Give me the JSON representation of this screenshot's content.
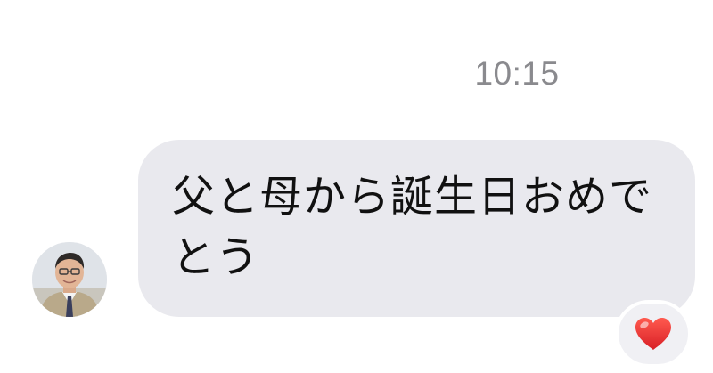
{
  "message": {
    "timestamp": "10:15",
    "text": "父と母から誕生日おめでとう",
    "reaction_icon": "heart-icon",
    "bubble_color": "#e9e9ee",
    "reaction_color": "#e8302f"
  }
}
